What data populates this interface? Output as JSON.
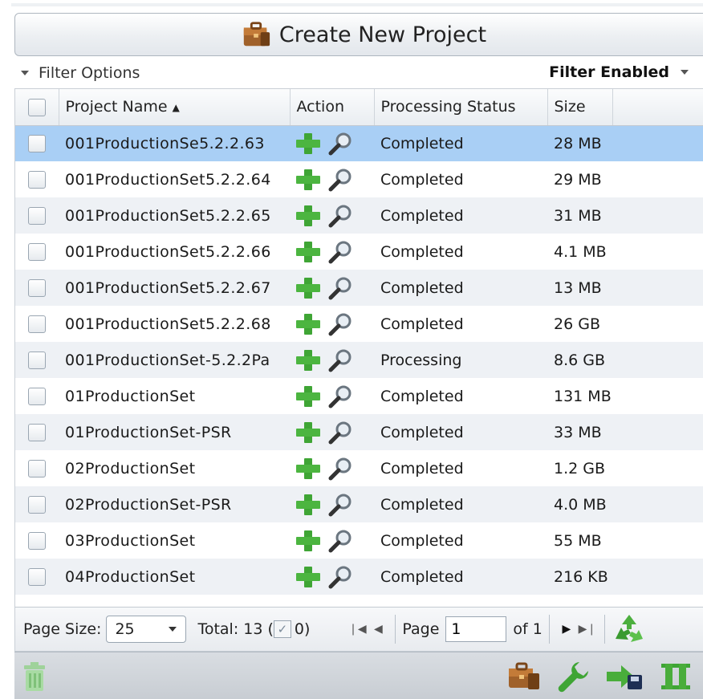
{
  "header": {
    "create_button_label": "Create New Project"
  },
  "filter": {
    "options_label": "Filter Options",
    "status_label": "Filter Enabled"
  },
  "grid": {
    "columns": [
      "Project Name",
      "Action",
      "Processing Status",
      "Size"
    ],
    "rows": [
      {
        "name": "001ProductionSe5.2.2.63",
        "status": "Completed",
        "size": "28 MB"
      },
      {
        "name": "001ProductionSet5.2.2.64",
        "status": "Completed",
        "size": "29 MB"
      },
      {
        "name": "001ProductionSet5.2.2.65",
        "status": "Completed",
        "size": "31 MB"
      },
      {
        "name": "001ProductionSet5.2.2.66",
        "status": "Completed",
        "size": "4.1 MB"
      },
      {
        "name": "001ProductionSet5.2.2.67",
        "status": "Completed",
        "size": "13 MB"
      },
      {
        "name": "001ProductionSet5.2.2.68",
        "status": "Completed",
        "size": "26 GB"
      },
      {
        "name": "001ProductionSet-5.2.2Pa",
        "status": "Processing",
        "size": "8.6 GB"
      },
      {
        "name": "01ProductionSet",
        "status": "Completed",
        "size": "131 MB"
      },
      {
        "name": "01ProductionSet-PSR",
        "status": "Completed",
        "size": "33 MB"
      },
      {
        "name": "02ProductionSet",
        "status": "Completed",
        "size": "1.2 GB"
      },
      {
        "name": "02ProductionSet-PSR",
        "status": "Completed",
        "size": "4.0 MB"
      },
      {
        "name": "03ProductionSet",
        "status": "Completed",
        "size": "55 MB"
      },
      {
        "name": "04ProductionSet",
        "status": "Completed",
        "size": "216 KB"
      }
    ]
  },
  "pager": {
    "page_size_label": "Page Size:",
    "page_size_value": "25",
    "total_label": "Total: 13 (",
    "selected_count": "0)",
    "page_label": "Page",
    "page_value": "1",
    "of_label": "of 1"
  },
  "icons": {
    "create": "briefcase-icon",
    "add": "plus-icon",
    "view": "magnifier-icon",
    "refresh": "recycle-icon",
    "delete": "trash-icon",
    "edit": "wrench-icon",
    "export": "export-icon",
    "pause": "pause-icon"
  },
  "colors": {
    "selected_row": "#a9cff5",
    "alt_row": "#eef1f5",
    "accent_green": "#3fa535"
  }
}
